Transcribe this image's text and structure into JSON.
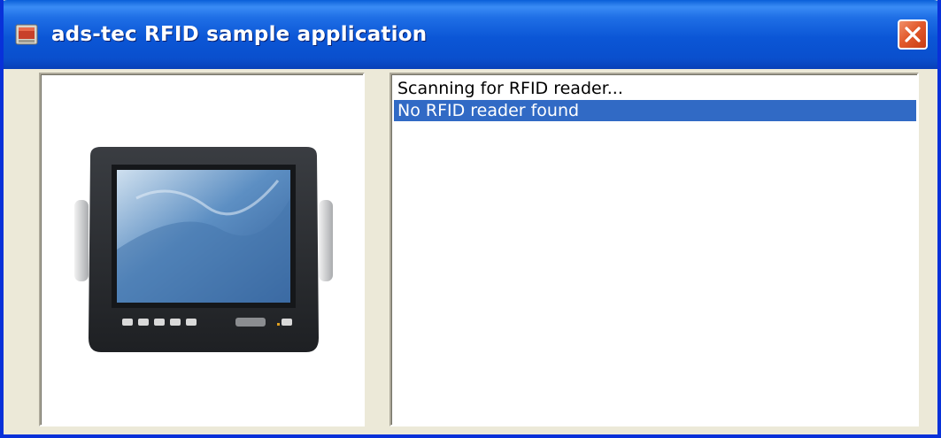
{
  "window": {
    "title": "ads-tec RFID sample application",
    "colors": {
      "titlebar": "#0a56d6",
      "face": "#ece9d8",
      "selection": "#316ac5",
      "close": "#e25a2c"
    }
  },
  "icons": {
    "app": "app-window-icon",
    "close": "close-x-icon",
    "device": "rugged-tablet-device"
  },
  "status_list": {
    "items": [
      {
        "text": "Scanning for RFID reader...",
        "selected": false
      },
      {
        "text": "No RFID reader found",
        "selected": true
      }
    ]
  }
}
